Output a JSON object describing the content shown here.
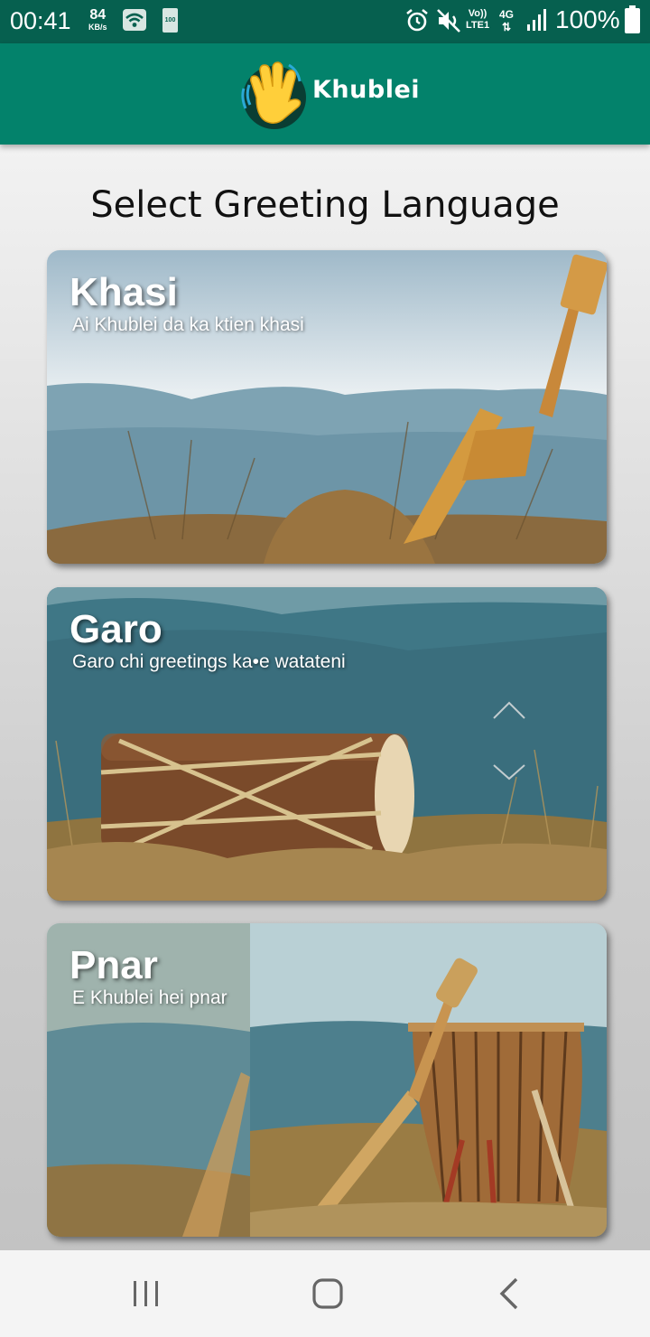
{
  "status_bar": {
    "time": "00:41",
    "net_speed": "84",
    "net_unit": "KB/s",
    "battery_small": "100",
    "volte_top": "Vo))",
    "volte_bottom": "LTE1",
    "network_type": "4G",
    "battery_percent": "100%"
  },
  "app_bar": {
    "title": "Khublei",
    "logo_icon": "waving-hand-icon"
  },
  "page": {
    "title": "Select Greeting Language"
  },
  "languages": [
    {
      "name": "Khasi",
      "greeting": "Ai Khublei da ka ktien khasi",
      "image": "duitara-string-instrument-on-hill"
    },
    {
      "name": "Garo",
      "greeting": "Garo chi greetings ka•e watateni",
      "image": "wooden-drum-on-grass"
    },
    {
      "name": "Pnar",
      "greeting": "E Khublei hei pnar",
      "image": "string-instrument-and-drum-with-flute"
    }
  ],
  "colors": {
    "status_bar": "#06604f",
    "app_bar": "#03826b",
    "accent_text": "#ffffff"
  },
  "nav_bar": {
    "icons": [
      "recent-apps-icon",
      "home-icon",
      "back-icon"
    ]
  }
}
